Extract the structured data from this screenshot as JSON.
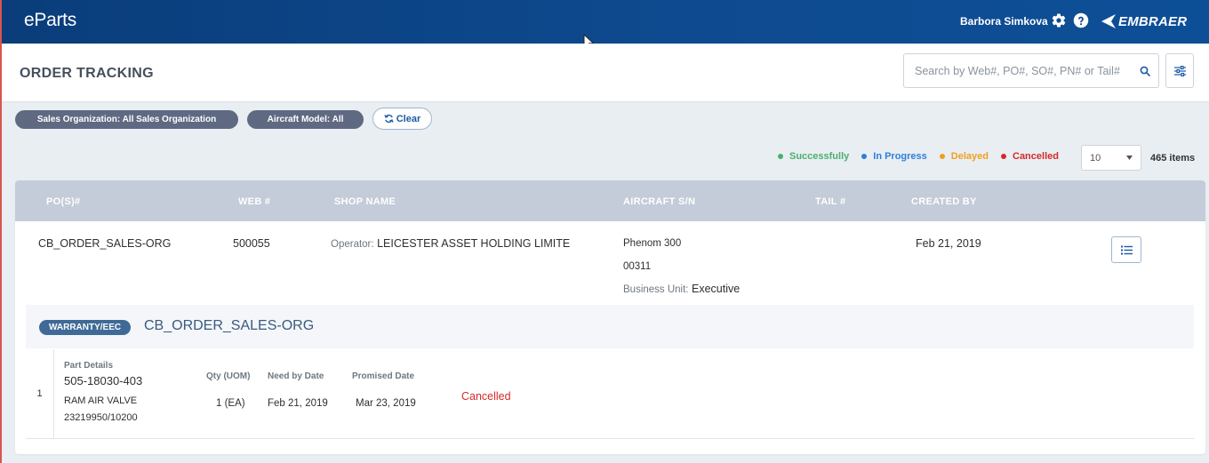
{
  "app": {
    "name": "eParts",
    "brand": "EMBRAER"
  },
  "user": {
    "name": "Barbora Simkova"
  },
  "page": {
    "title": "ORDER TRACKING"
  },
  "search": {
    "placeholder": "Search by Web#, PO#, SO#, PN# or Tail#..."
  },
  "filters": {
    "sales_org": "Sales Organization: All Sales Organization",
    "aircraft_model": "Aircraft Model: All",
    "clear_label": "Clear"
  },
  "legend": [
    {
      "label": "Successfully",
      "color": "#4caf6e"
    },
    {
      "label": "In Progress",
      "color": "#2f7fd8"
    },
    {
      "label": "Delayed",
      "color": "#f0a020"
    },
    {
      "label": "Cancelled",
      "color": "#d42a2a"
    }
  ],
  "pagination": {
    "page_size": "10",
    "items_count": "465 items"
  },
  "table": {
    "columns": [
      "PO(S)#",
      "WEB #",
      "SHOP NAME",
      "AIRCRAFT S/N",
      "TAIL #",
      "CREATED BY"
    ],
    "row": {
      "po": "CB_ORDER_SALES-ORG",
      "web": "500055",
      "operator_label": "Operator:",
      "operator": "LEICESTER ASSET HOLDING LIMITE",
      "aircraft_model": "Phenom 300",
      "aircraft_sn": "00311",
      "business_unit_label": "Business Unit:",
      "business_unit": "Executive",
      "created": "Feb 21, 2019"
    }
  },
  "order": {
    "badge": "WARRANTY/EEC",
    "title": "CB_ORDER_SALES-ORG",
    "lines": [
      {
        "number": "1",
        "part_details_label": "Part Details",
        "part_number": "505-18030-403",
        "description": "RAM AIR VALVE",
        "ref": "23219950/10200",
        "qty_label": "Qty (UOM)",
        "qty": "1 (EA)",
        "need_label": "Need by Date",
        "need_date": "Feb 21, 2019",
        "promised_label": "Promised Date",
        "promised_date": "Mar 23, 2019",
        "status": "Cancelled",
        "status_color": "#d42a2a"
      }
    ]
  }
}
